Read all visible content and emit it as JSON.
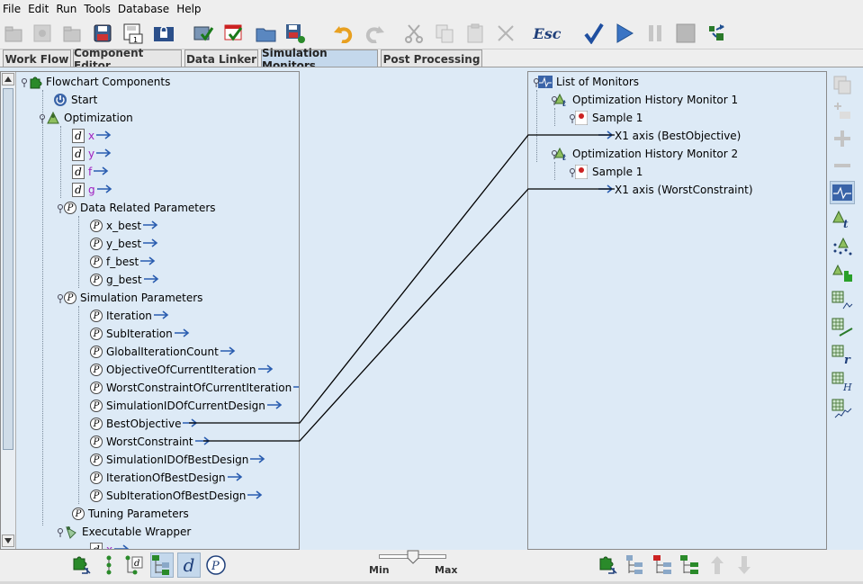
{
  "menu": [
    "File",
    "Edit",
    "Run",
    "Tools",
    "Database",
    "Help"
  ],
  "toolbar_icons": [
    "new-icon",
    "grayed-icon",
    "open-icon",
    "save-icon",
    "save-as-icon",
    "lock-icon",
    "check-model-icon",
    "validate-icon",
    "folder-icon",
    "save-run-icon",
    "undo-icon",
    "redo-icon",
    "cut-icon",
    "copy-icon",
    "paste-icon",
    "delete-icon",
    "esc-icon",
    "check-icon",
    "run-icon",
    "pause-icon",
    "stop-icon",
    "run-component-icon"
  ],
  "toolbar": {
    "esc_label": "Esc"
  },
  "tabs": [
    "Work Flow",
    "Component Editor",
    "Data Linker",
    "Simulation Monitors",
    "Post Processing"
  ],
  "active_tab": "Simulation Monitors",
  "left_tree": {
    "root": "Flowchart Components",
    "start": "Start",
    "optimization": "Optimization",
    "variables": [
      "x",
      "y",
      "f",
      "g"
    ],
    "data_related": "Data Related Parameters",
    "data_params": [
      "x_best",
      "y_best",
      "f_best",
      "g_best"
    ],
    "simulation": "Simulation Parameters",
    "sim_params": [
      "Iteration",
      "SubIteration",
      "GlobalIterationCount",
      "ObjectiveOfCurrentIteration",
      "WorstConstraintOfCurrentIteration",
      "SimulationIDOfCurrentDesign",
      "BestObjective",
      "WorstConstraint",
      "SimulationIDOfBestDesign",
      "IterationOfBestDesign",
      "SubIterationOfBestDesign"
    ],
    "tuning": "Tuning Parameters",
    "executable": "Executable Wrapper",
    "exec_var": "x"
  },
  "right_tree": {
    "root": "List of Monitors",
    "monitors": [
      {
        "name": "Optimization History Monitor 1",
        "sample": "Sample 1",
        "axis": "X1 axis (BestObjective)"
      },
      {
        "name": "Optimization History Monitor 2",
        "sample": "Sample 1",
        "axis": "X1 axis (WorstConstraint)"
      }
    ]
  },
  "slider": {
    "min_label": "Min",
    "max_label": "Max"
  },
  "colors": {
    "accent": "#c4d8ec",
    "panel": "#ddeaf6",
    "arrow": "#2a5db0",
    "var_purple": "#a020c0"
  }
}
